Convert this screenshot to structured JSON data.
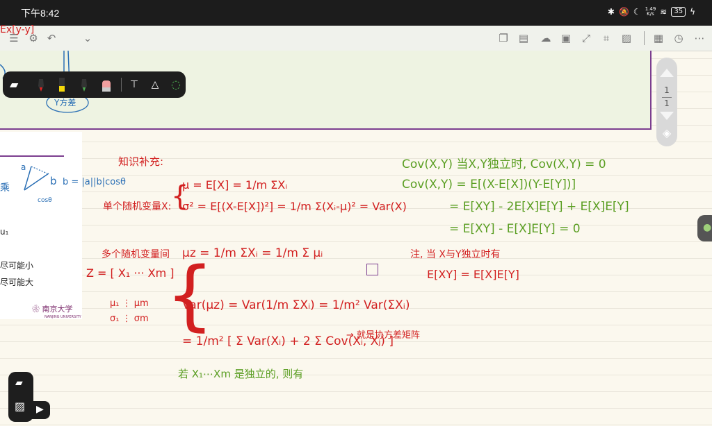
{
  "status": {
    "time": "下午8:42",
    "net_rate": "1.49\nK/s",
    "battery": "35"
  },
  "toolbar": {
    "icons_left": [
      "menu-icon",
      "settings-icon",
      "undo-icon",
      "chevron-down-icon"
    ],
    "icons_right": [
      "copy-icon",
      "list-icon",
      "cloud-icon",
      "save-icon",
      "expand-icon",
      "crop-icon",
      "image-icon",
      "notes-icon",
      "history-icon",
      "more-icon"
    ]
  },
  "scroller": {
    "page_current": "1",
    "page_total": "1"
  },
  "side_panel": {
    "vector_label": "b = |a||b|cosθ",
    "small_a": "a",
    "small_b": "b",
    "small_cos": "cosθ",
    "partial_char": "乘",
    "mu1": "u₁",
    "line1": "尽可能小",
    "line2": "尽可能大",
    "logo": "南京大学",
    "logo_sub": "NANJING UNIVERSITY"
  },
  "green_box": {
    "handwriting": "Ex[y-y]",
    "label": "Y方差"
  },
  "notes": {
    "red": {
      "title": "知识补充:",
      "single_var": "单个随机变量X:",
      "mu_eq": "μ = E[X] = 1/m ΣXᵢ",
      "sigma_eq": "σ² = E[(X-E[X])²] = 1/m Σ(Xᵢ-μ)² = Var(X)",
      "multi_var": "多个随机变量间",
      "z_def": "Z = [ X₁ ··· Xm ]",
      "mu_z": "μz = 1/m ΣXᵢ = 1/m Σ μᵢ",
      "mu_col": "μ₁ ⋮ μm",
      "sigma_col": "σ₁ ⋮ σm",
      "var_z": "Var(μz) = Var(1/m ΣXᵢ) = 1/m² Var(ΣXᵢ)",
      "var_expand": "= 1/m² [ Σ Var(Xᵢ) + 2 Σ Cov(Xᵢ, Xⱼ) ]",
      "cov_matrix_note": "→ 就是协方差矩阵",
      "note_indep": "注, 当 X与Y独立时有",
      "exy": "E[XY] = E[X]E[Y]"
    },
    "green": {
      "cov_indep": "Cov(X,Y) 当X,Y独立时, Cov(X,Y) = 0",
      "cov_line1": "Cov(X,Y) = E[(X-E[X])(Y-E[Y])]",
      "cov_line2": "= E[XY] - 2E[X]E[Y] + E[X]E[Y]",
      "cov_line3": "= E[XY] - E[X]E[Y] = 0",
      "indep_note": "若 X₁⋯Xm 是独立的, 则有"
    }
  }
}
